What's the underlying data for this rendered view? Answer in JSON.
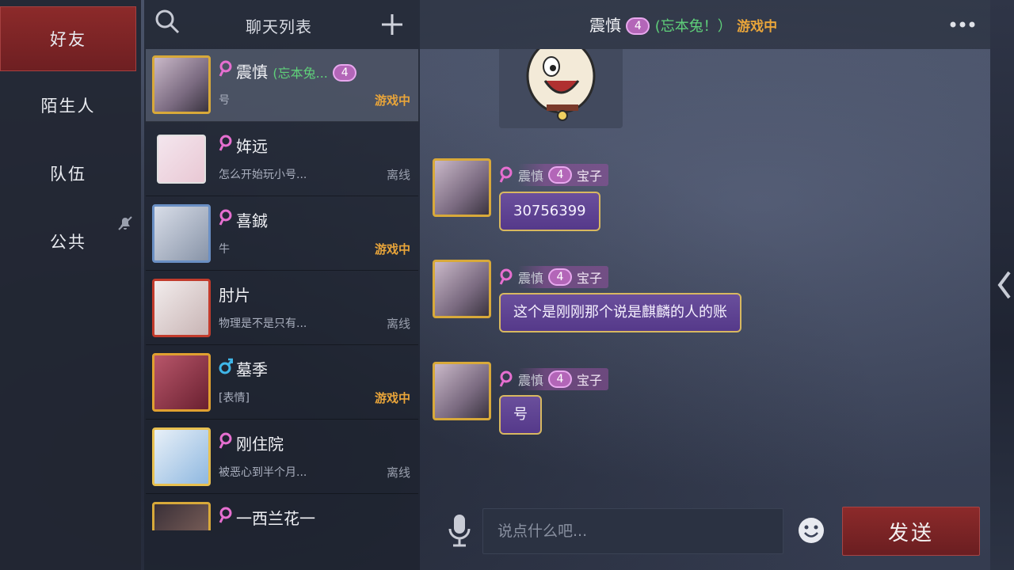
{
  "categories": [
    {
      "label": "好友",
      "active": true
    },
    {
      "label": "陌生人",
      "active": false
    },
    {
      "label": "队伍",
      "active": false
    },
    {
      "label": "公共",
      "active": false
    }
  ],
  "list_header": {
    "title": "聊天列表"
  },
  "chats": [
    {
      "name": "震慎",
      "remark": "(忘本兔...",
      "level": "4",
      "preview": "号",
      "status": "游戏中",
      "online": true,
      "gender": "female",
      "avatar": "framed-couple"
    },
    {
      "name": "姩远",
      "remark": "",
      "level": "",
      "preview": "怎么开始玩小号...",
      "status": "离线",
      "online": false,
      "gender": "female",
      "avatar": "pink-sketch"
    },
    {
      "name": "喜鋮",
      "remark": "",
      "level": "",
      "preview": "牛",
      "status": "游戏中",
      "online": true,
      "gender": "female",
      "avatar": "blue-frame"
    },
    {
      "name": "肘片",
      "remark": "",
      "level": "",
      "preview": "物理是不是只有...",
      "status": "离线",
      "online": false,
      "gender": "none",
      "avatar": "red-frame"
    },
    {
      "name": "墓季",
      "remark": "",
      "level": "",
      "preview": "[表情]",
      "status": "游戏中",
      "online": true,
      "gender": "male",
      "avatar": "fire-frame"
    },
    {
      "name": "刚住院",
      "remark": "",
      "level": "",
      "preview": "被恶心到半个月...",
      "status": "离线",
      "online": false,
      "gender": "female",
      "avatar": "gold-frame"
    },
    {
      "name": "一西兰花一",
      "remark": "",
      "level": "",
      "preview": "",
      "status": "",
      "online": false,
      "gender": "female",
      "avatar": "dark-frame"
    }
  ],
  "conversation": {
    "name": "震慎",
    "level": "4",
    "remark": "(忘本兔！）",
    "status": "游戏中",
    "messages": [
      {
        "sender": "震慎",
        "level": "4",
        "tag": "宝子",
        "text": "30756399"
      },
      {
        "sender": "震慎",
        "level": "4",
        "tag": "宝子",
        "text": "这个是刚刚那个说是麒麟的人的账"
      },
      {
        "sender": "震慎",
        "level": "4",
        "tag": "宝子",
        "text": "号"
      }
    ]
  },
  "input": {
    "placeholder": "说点什么吧...",
    "value": ""
  },
  "send_button": {
    "label": "发送"
  },
  "colors": {
    "online": "#e9a53a",
    "offline": "#9aa0ae",
    "remark": "#5fd07a",
    "accent_red": "#8c2a2a",
    "bubble": "#5f4494",
    "female": "#e66fd0",
    "male": "#3fb6e8"
  },
  "icons": {
    "search": "search-icon",
    "plus": "plus-icon",
    "more": "more-icon",
    "mic": "mic-icon",
    "emoji": "emoji-icon",
    "mute": "mute-icon"
  }
}
